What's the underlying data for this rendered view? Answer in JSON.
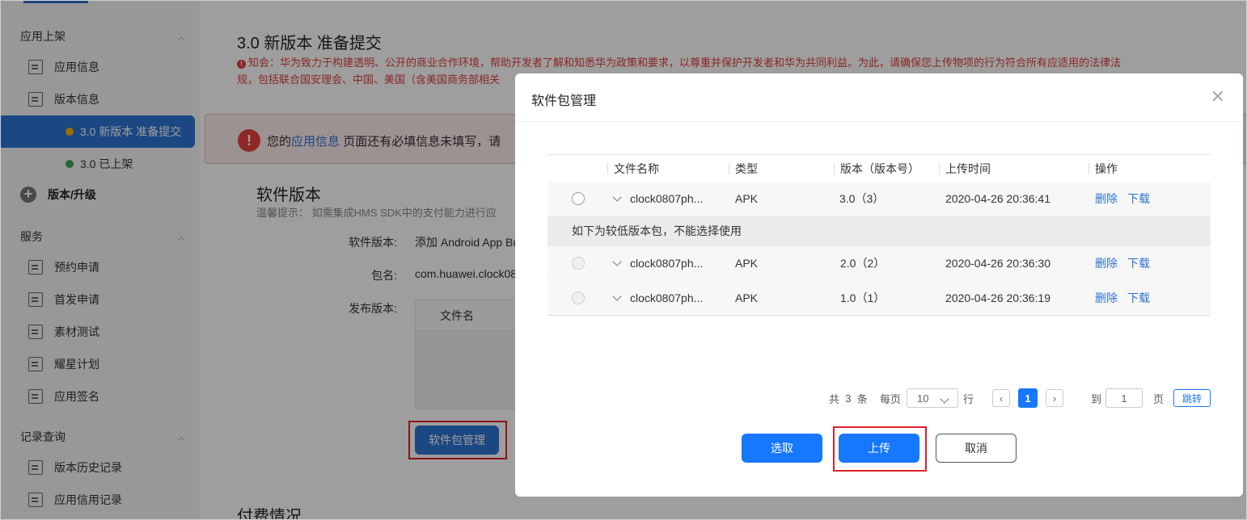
{
  "sidebar": {
    "sections": [
      {
        "label": "应用上架"
      },
      {
        "label": "服务"
      },
      {
        "label": "记录查询"
      }
    ],
    "app_items": [
      {
        "label": "应用信息"
      },
      {
        "label": "版本信息"
      }
    ],
    "version_subitems": [
      {
        "label": "3.0 新版本 准备提交",
        "dot_color": "#f0b400",
        "active": true
      },
      {
        "label": "3.0 已上架",
        "dot_color": "#3aa85a",
        "active": false
      }
    ],
    "add_version_label": "版本/升级",
    "service_items": [
      {
        "label": "预约申请"
      },
      {
        "label": "首发申请"
      },
      {
        "label": "素材测试"
      },
      {
        "label": "耀星计划"
      },
      {
        "label": "应用签名"
      }
    ],
    "record_items": [
      {
        "label": "版本历史记录"
      },
      {
        "label": "应用信用记录"
      }
    ]
  },
  "main": {
    "title": "3.0  新版本  准备提交",
    "notice_line1": "知会：华为致力于构建透明、公开的商业合作环境，帮助开发者了解和知悉华为政策和要求，以尊重并保护开发者和华为共同利益。为此，请确保您上传物项的行为符合所有应适用的法律法",
    "notice_line2": "规，包括联合国安理会、中国、美国（含美国商务部相关",
    "alert_prefix": "您的",
    "alert_link": "应用信息",
    "alert_suffix": "页面还有必填信息未填写，请",
    "software_title": "软件版本",
    "software_tip": "温馨提示：  如需集成HMS SDK中的支付能力进行应",
    "form": {
      "version_label": "软件版本:",
      "version_value": "添加 Android App Bu",
      "package_label": "包名:",
      "package_value": "com.huawei.clock08",
      "release_label": "发布版本:",
      "file_col": "文件名"
    },
    "pkg_button": "软件包管理",
    "pay_title": "付费情况"
  },
  "modal": {
    "title": "软件包管理",
    "columns": [
      "文件名称",
      "类型",
      "版本（版本号）",
      "上传时间",
      "操作"
    ],
    "rows": [
      {
        "name": "clock0807ph...",
        "type": "APK",
        "version": "3.0（3）",
        "time": "2020-04-26 20:36:41",
        "delete": "删除",
        "download": "下载"
      },
      {
        "name": "clock0807ph...",
        "type": "APK",
        "version": "2.0（2）",
        "time": "2020-04-26 20:36:30",
        "delete": "删除",
        "download": "下载"
      },
      {
        "name": "clock0807ph...",
        "type": "APK",
        "version": "1.0（1）",
        "time": "2020-04-26 20:36:19",
        "delete": "删除",
        "download": "下载"
      }
    ],
    "lower_version_note": "如下为较低版本包，不能选择使用",
    "pager": {
      "total_prefix": "共",
      "total": "3",
      "total_suffix": "条",
      "per_page_label": "每页",
      "per_page": "10",
      "row_label": "行",
      "current_page": "1",
      "goto_label": "到",
      "goto_value": "1",
      "page_label": "页",
      "jump": "跳转"
    },
    "buttons": {
      "select": "选取",
      "upload": "上传",
      "cancel": "取消"
    }
  },
  "colors": {
    "primary": "#1677ff",
    "sidebar_active": "#2c73d2",
    "warning_red": "#e03d3d",
    "highlight_box": "#e0202a"
  }
}
